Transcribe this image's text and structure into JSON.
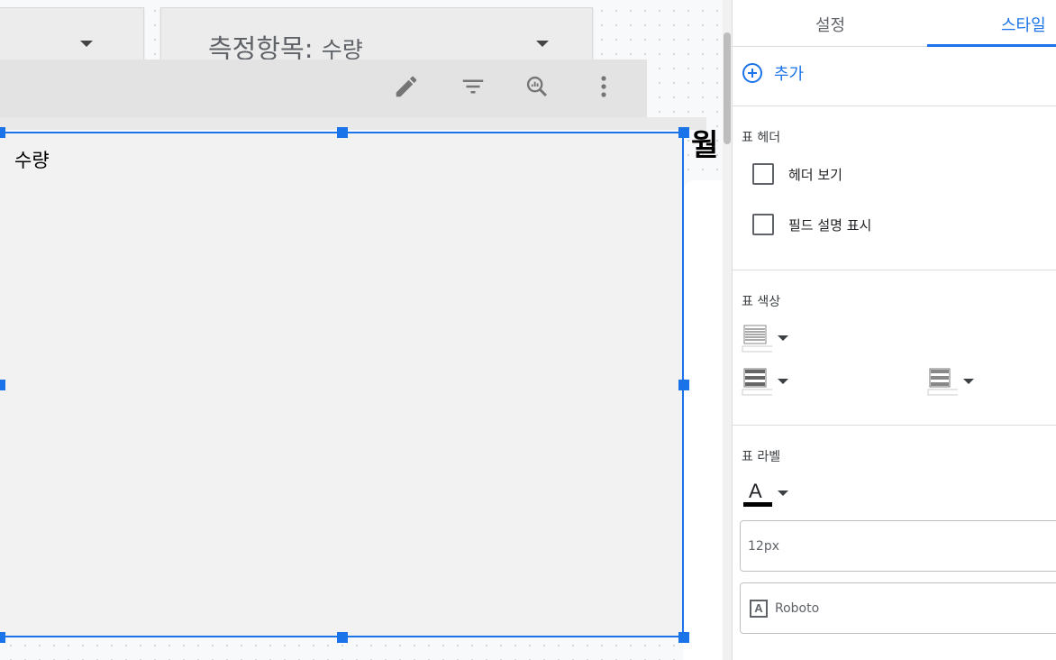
{
  "canvas": {
    "metric_control": {
      "label": "측정항목",
      "separator": ":",
      "value": "수량"
    },
    "table_chart": {
      "title": "수량"
    },
    "next_chart_text": "월"
  },
  "panel": {
    "tabs": [
      {
        "label": "설정",
        "active": false
      },
      {
        "label": "스타일",
        "active": true
      }
    ],
    "add_label": "추가",
    "table_header": {
      "title": "표 헤더",
      "options": [
        {
          "label": "헤더 보기",
          "checked": false
        },
        {
          "label": "필드 설명 표시",
          "checked": false
        }
      ]
    },
    "table_colors": {
      "title": "표 색상"
    },
    "table_labels": {
      "title": "표 라벨",
      "font_color_glyph": "A",
      "font_size": "12px",
      "font_family_glyph": "A",
      "font_family": "Roboto"
    }
  },
  "colors": {
    "accent": "#1a73e8",
    "selection": "#1a73e8",
    "chart_bg": "#f2f2f2"
  }
}
